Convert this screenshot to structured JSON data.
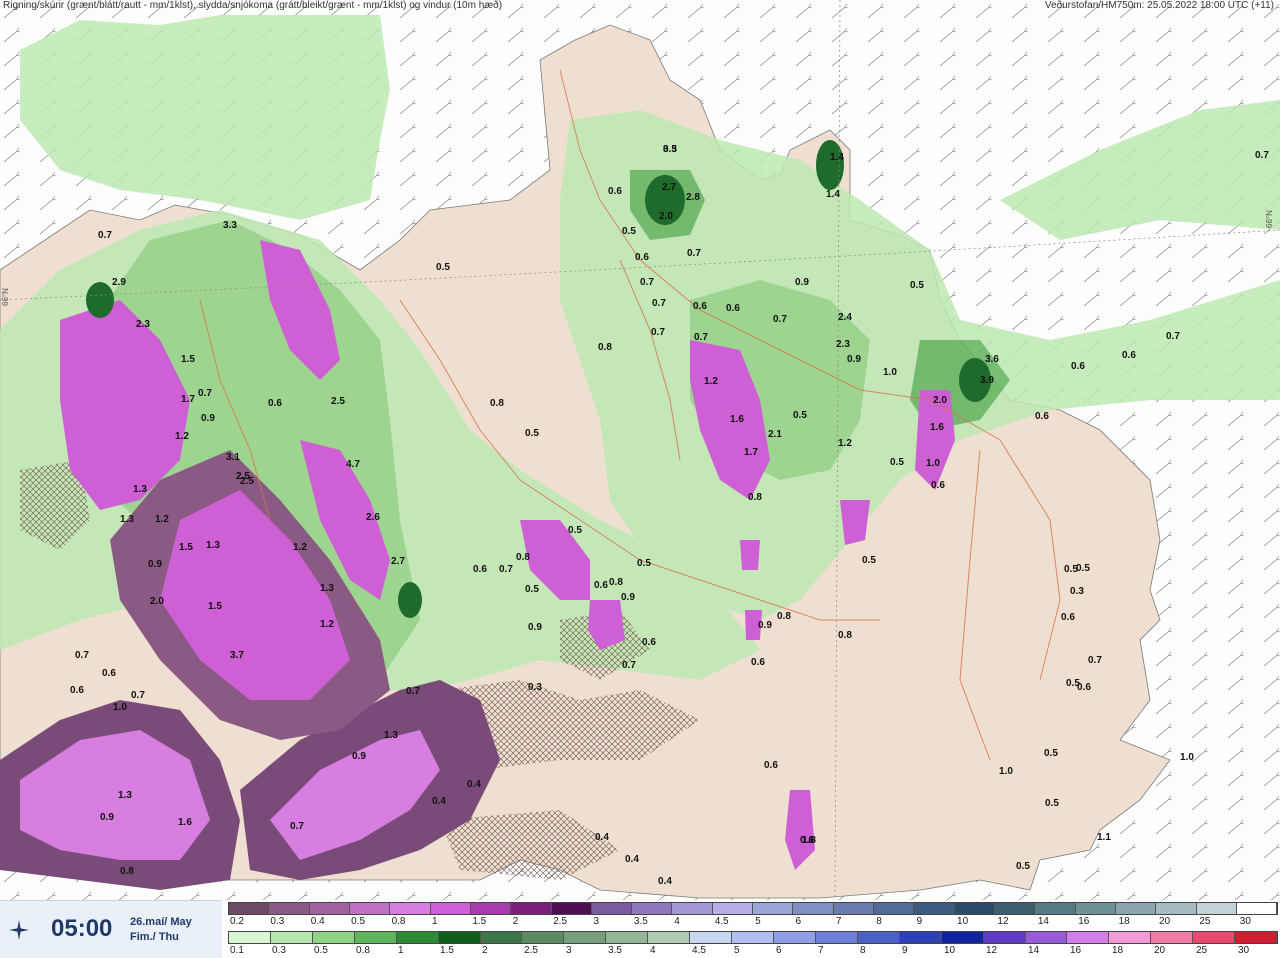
{
  "header": {
    "left_title": "Rigning/skúrir (grænt/blátt/rautt - mm/1klst), slydda/snjókoma (grátt/bleikt/grænt - mm/1klst) og vindur (10m hæð)",
    "right_title": "Veðurstofan/HM750m: 25.05.2022 18:00 UTC (+11)"
  },
  "map": {
    "graticule_left": "66°N",
    "graticule_right": "66°N",
    "value_labels": [
      "0.5",
      "2.7",
      "2.8",
      "2.0",
      "0.6",
      "0.5",
      "0.6",
      "0.7",
      "1.4",
      "1.4",
      "0.7",
      "0.7",
      "0.8",
      "0.6",
      "0.9",
      "0.5",
      "0.6",
      "0.7",
      "0.7",
      "2.4",
      "2.3",
      "0.9",
      "0.7",
      "1.0",
      "3.6",
      "3.9",
      "0.6",
      "0.7",
      "0.7",
      "0.6",
      "0.6",
      "1.2",
      "1.6",
      "2.1",
      "1.7",
      "0.8",
      "0.5",
      "1.2",
      "0.5",
      "1.0",
      "1.6",
      "2.0",
      "0.6",
      "3.3",
      "2.5",
      "0.7",
      "2.9",
      "2.3",
      "1.5",
      "1.7",
      "0.7",
      "0.9",
      "1.2",
      "0.6",
      "2.5",
      "4.7",
      "2.6",
      "3.1",
      "2.5",
      "1.3",
      "1.3",
      "1.2",
      "1.3",
      "0.9",
      "2.0",
      "1.5",
      "1.5",
      "1.2",
      "1.3",
      "1.2",
      "3.7",
      "2.7",
      "0.7",
      "0.6",
      "0.6",
      "0.7",
      "1.0",
      "0.7",
      "0.9",
      "1.3",
      "0.9",
      "1.3",
      "1.6",
      "0.8",
      "0.4",
      "0.4",
      "0.7",
      "0.3",
      "0.4",
      "0.4",
      "0.4",
      "0.5",
      "0.5",
      "0.8",
      "0.6",
      "0.6",
      "0.5",
      "0.6",
      "0.9",
      "0.7",
      "0.5",
      "0.6",
      "0.8",
      "0.7",
      "0.8",
      "0.9",
      "0.6",
      "0.8",
      "0.5",
      "0.6",
      "0.6",
      "0.5",
      "0.3",
      "0.7",
      "0.5",
      "0.5",
      "1.1",
      "1.0",
      "0.5",
      "0.6",
      "1.8",
      "0.9",
      "0.8",
      "0.5",
      "0.5",
      "1.0",
      "0.5",
      "3.3"
    ]
  },
  "time_panel": {
    "time": "05:00",
    "date_line1": "26.maí/ May",
    "date_line2": "Fim./ Thu",
    "logo": "vedurstofan-logo-icon"
  },
  "legend_snow": {
    "labels": [
      "0.2",
      "0.3",
      "0.4",
      "0.5",
      "0.8",
      "1",
      "1.5",
      "2",
      "2.5",
      "3",
      "3.5",
      "4",
      "4.5",
      "5",
      "6",
      "7",
      "8",
      "9",
      "10",
      "12",
      "14",
      "16",
      "18",
      "20",
      "25",
      "30"
    ],
    "colors": [
      "#6b4a66",
      "#8a5a84",
      "#a062a0",
      "#c070c4",
      "#d77ee0",
      "#cf5fd4",
      "#a83aab",
      "#7a1f7c",
      "#4e0f50",
      "#7a5aa0",
      "#8f78bd",
      "#a596d6",
      "#b6aee6",
      "#9aa6d8",
      "#7f8fc4",
      "#6a7bb0",
      "#536a98",
      "#3d5a80",
      "#2d4a6a",
      "#3b5f6e",
      "#557b85",
      "#6f9099",
      "#8aa5ad",
      "#a6bcc1",
      "#c3d2d5",
      "#ffffff"
    ]
  },
  "legend_rain": {
    "labels": [
      "0.1",
      "0.3",
      "0.5",
      "0.8",
      "1",
      "1.5",
      "2",
      "2.5",
      "3",
      "3.5",
      "4",
      "4.5",
      "5",
      "6",
      "7",
      "8",
      "9",
      "10",
      "12",
      "14",
      "16",
      "18",
      "20",
      "25",
      "30"
    ],
    "colors": [
      "#d9f7d3",
      "#b5e8ac",
      "#8fd486",
      "#5fb45d",
      "#2e8a35",
      "#0f5e1e",
      "#3e7748",
      "#5a8c60",
      "#77a17c",
      "#93b698",
      "#b0cbb4",
      "#c9d6f0",
      "#b0bff0",
      "#8e9fe6",
      "#6c80d8",
      "#4a62c8",
      "#2b42b6",
      "#1024a0",
      "#5e3bc0",
      "#9a5ad8",
      "#d27ee8",
      "#f09ad8",
      "#f07aa8",
      "#e84a70",
      "#d01e2e"
    ]
  }
}
